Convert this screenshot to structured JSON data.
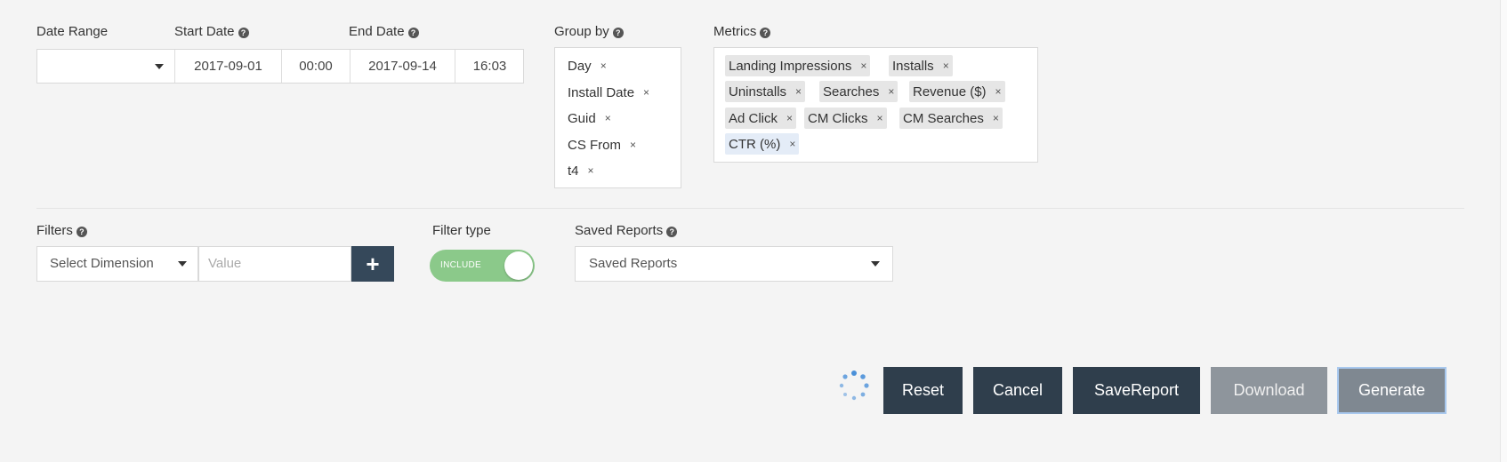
{
  "date": {
    "range_label": "Date Range",
    "start_label": "Start Date",
    "end_label": "End Date",
    "range_value": "",
    "start_date": "2017-09-01",
    "start_time": "00:00",
    "end_date": "2017-09-14",
    "end_time": "16:03"
  },
  "group_by": {
    "label": "Group by",
    "tags": [
      "Day",
      "Install Date",
      "Guid",
      "CS From",
      "t4"
    ]
  },
  "metrics": {
    "label": "Metrics",
    "tags": [
      "Landing Impressions",
      "Installs",
      "Uninstalls",
      "Searches",
      "Revenue ($)",
      "Ad Click",
      "CM Clicks",
      "CM Searches",
      "CTR (%)"
    ]
  },
  "filters": {
    "label": "Filters",
    "dimension_placeholder": "Select Dimension",
    "value_placeholder": "Value",
    "add_glyph": "+"
  },
  "filter_type": {
    "label": "Filter type",
    "toggle_text": "INCLUDE"
  },
  "saved_reports": {
    "label": "Saved Reports",
    "selected": "Saved Reports"
  },
  "help_glyph": "?",
  "remove_glyph": "×",
  "actions": {
    "reset": "Reset",
    "cancel": "Cancel",
    "save": "SaveReport",
    "download": "Download",
    "generate": "Generate"
  },
  "colors": {
    "dark_button": "#2f3e4c",
    "disabled_button": "#8e959c",
    "toggle_on": "#8bc98a",
    "spinner": "#4a90d9"
  }
}
